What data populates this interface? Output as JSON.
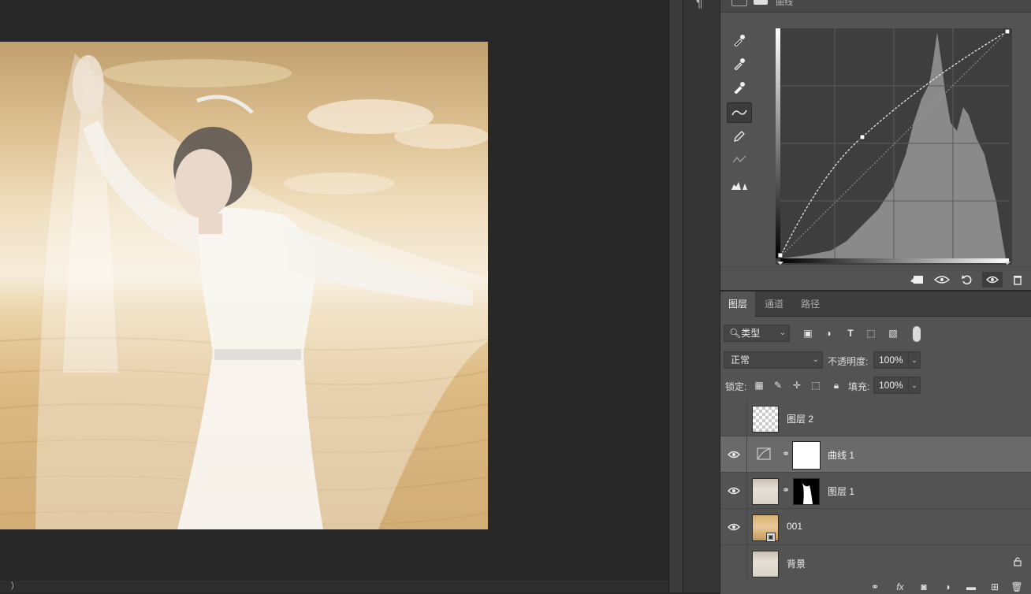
{
  "properties_panel": {
    "title": "曲线",
    "tools": [
      "eyedropper-black-icon",
      "eyedropper-gray-icon",
      "eyedropper-white-icon",
      "curve-edit-icon",
      "pencil-icon",
      "smooth-icon",
      "histogram-warning-icon"
    ],
    "footer_icons": [
      "clip-to-layer-icon",
      "view-previous-icon",
      "reset-icon",
      "visibility-icon",
      "delete-icon"
    ]
  },
  "layers_panel": {
    "tabs": [
      {
        "label": "图层",
        "active": true
      },
      {
        "label": "通道",
        "active": false
      },
      {
        "label": "路径",
        "active": false
      }
    ],
    "filter": {
      "label": "类型"
    },
    "blend_mode": "正常",
    "opacity_label": "不透明度:",
    "opacity": "100%",
    "lock_label": "锁定:",
    "fill_label": "填充:",
    "fill": "100%",
    "layers": [
      {
        "name": "图层 2",
        "visible": false,
        "selected": false
      },
      {
        "name": "曲线 1",
        "visible": true,
        "selected": true
      },
      {
        "name": "图层 1",
        "visible": true,
        "selected": false
      },
      {
        "name": "001",
        "visible": true,
        "selected": false
      },
      {
        "name": "背景",
        "visible": false,
        "selected": false,
        "locked": true
      }
    ]
  },
  "status_bar": {
    "caret": ")"
  }
}
